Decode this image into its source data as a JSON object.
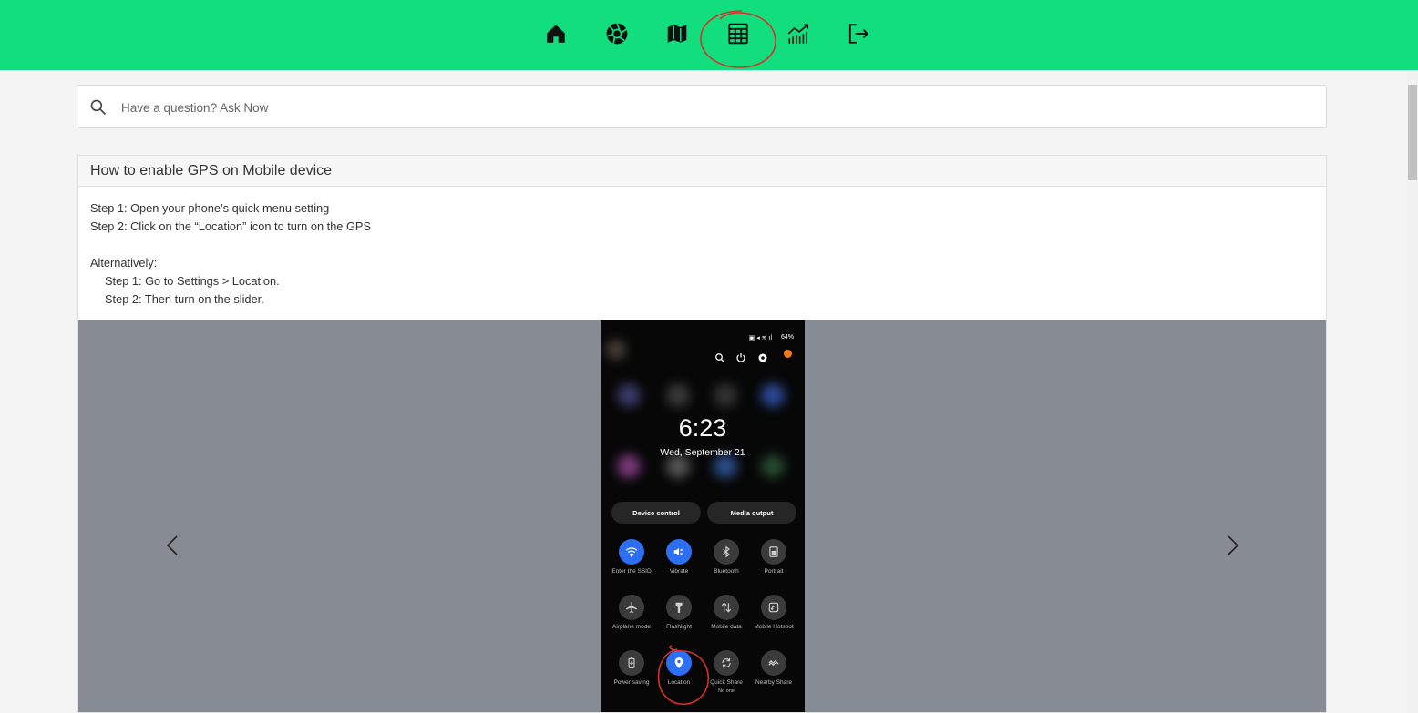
{
  "nav": {
    "items": [
      {
        "name": "home-icon"
      },
      {
        "name": "aperture-icon"
      },
      {
        "name": "map-icon"
      },
      {
        "name": "table-icon"
      },
      {
        "name": "chart-icon"
      },
      {
        "name": "logout-icon"
      }
    ],
    "highlighted": "table-icon"
  },
  "search": {
    "placeholder": "Have a question? Ask Now"
  },
  "faq": {
    "title": "How to enable GPS on Mobile device",
    "steps": [
      "Step 1: Open your phone’s quick menu setting",
      "Step 2: Click on the “Location” icon to turn on the GPS"
    ],
    "alternatively_label": "Alternatively:",
    "alt_steps": [
      "Step 1: Go to Settings > Location.",
      "Step 2: Then turn on the slider."
    ]
  },
  "phone": {
    "status": "64%",
    "time": "6:23",
    "date": "Wed, September 21",
    "pills": [
      "Device control",
      "Media output"
    ],
    "tiles": [
      {
        "label": "Enter the SSID",
        "icon": "wifi-icon",
        "on": true
      },
      {
        "label": "Vibrate",
        "icon": "vibrate-icon",
        "on": true
      },
      {
        "label": "Bluetooth",
        "icon": "bluetooth-icon",
        "on": false
      },
      {
        "label": "Portrait",
        "icon": "portrait-icon",
        "on": false
      },
      {
        "label": "Airplane mode",
        "icon": "airplane-icon",
        "on": false
      },
      {
        "label": "Flashlight",
        "icon": "flashlight-icon",
        "on": false
      },
      {
        "label": "Mobile data",
        "icon": "mobile-data-icon",
        "on": false
      },
      {
        "label": "Mobile Hotspot",
        "icon": "hotspot-icon",
        "on": false
      },
      {
        "label": "Power saving",
        "icon": "power-saving-icon",
        "on": false
      },
      {
        "label": "Location",
        "icon": "location-icon",
        "on": true
      },
      {
        "label": "Quick Share",
        "sublabel": "No one",
        "icon": "quick-share-icon",
        "on": false
      },
      {
        "label": "Nearby Share",
        "icon": "nearby-share-icon",
        "on": false
      }
    ]
  },
  "colors": {
    "topbar": "#12de7e",
    "annotation": "#d4322b",
    "tile_on": "#2d6ff3"
  }
}
